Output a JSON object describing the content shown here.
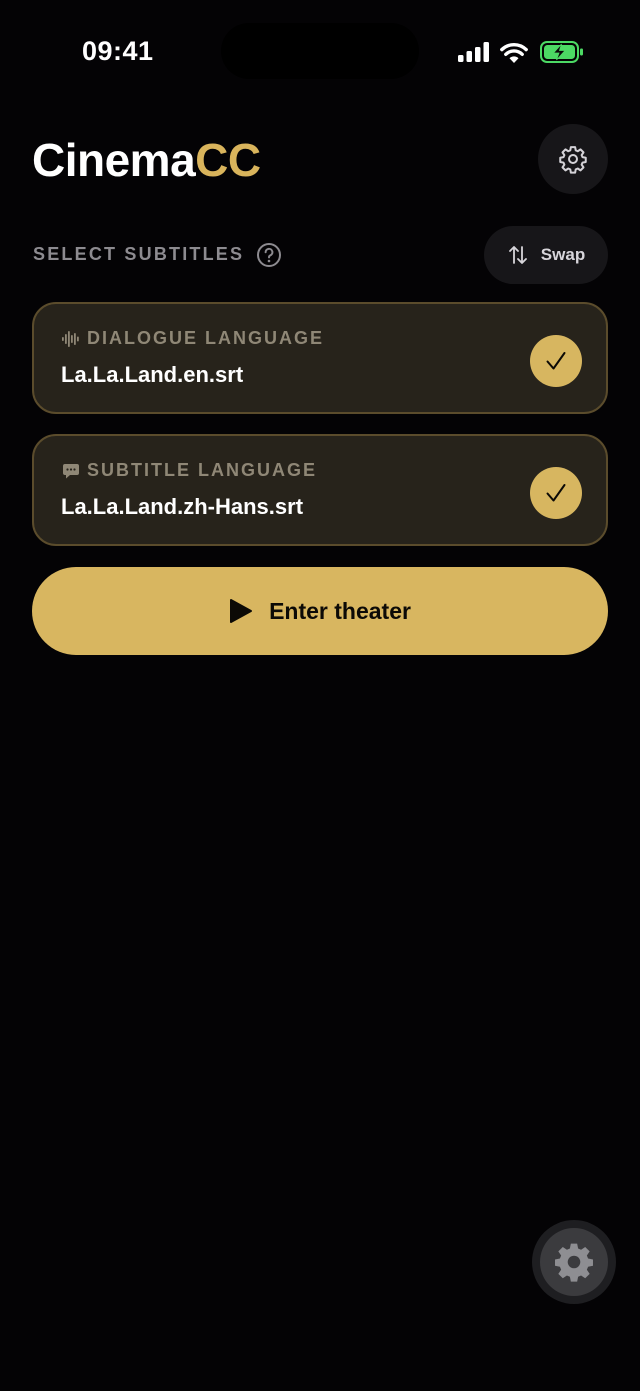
{
  "status_bar": {
    "time": "09:41"
  },
  "header": {
    "title_main": "Cinema",
    "title_accent": "CC"
  },
  "section": {
    "label": "SELECT SUBTITLES",
    "swap_label": "Swap"
  },
  "cards": [
    {
      "heading": "DIALOGUE LANGUAGE",
      "file": "La.La.Land.en.srt",
      "icon": "waveform-icon",
      "selected": true
    },
    {
      "heading": "SUBTITLE LANGUAGE",
      "file": "La.La.Land.zh-Hans.srt",
      "icon": "speech-bubble-icon",
      "selected": true
    }
  ],
  "primary_action": {
    "label": "Enter theater",
    "icon": "play-icon"
  },
  "colors": {
    "background": "#040305",
    "accent": "#d8b660",
    "card_background": "#27231b",
    "card_border": "#5b4c2c",
    "battery_green": "#4cd964"
  }
}
